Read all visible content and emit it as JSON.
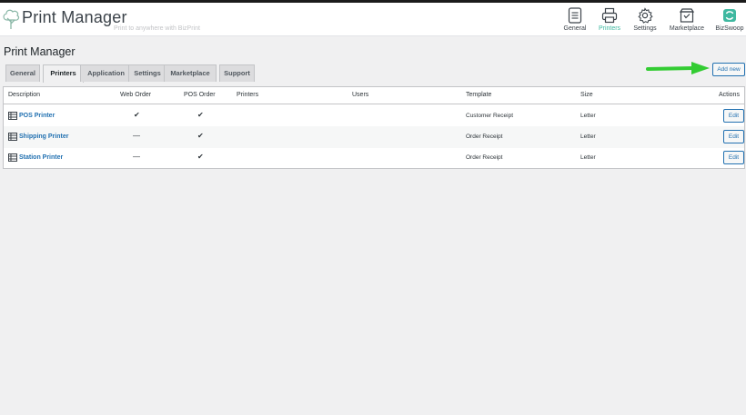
{
  "header": {
    "app_title": "Print Manager",
    "tagline": "Print to anywhere with BizPrint",
    "nav": [
      {
        "label": "General",
        "icon": "list-icon"
      },
      {
        "label": "Printers",
        "icon": "printer-icon"
      },
      {
        "label": "Settings",
        "icon": "gear-icon"
      },
      {
        "label": "Marketplace",
        "icon": "store-icon"
      },
      {
        "label": "BizSwoop",
        "icon": "bizswoop-icon"
      }
    ],
    "active_nav": "Printers",
    "accent_color": "#3fb8a0"
  },
  "page": {
    "title": "Print Manager",
    "tabs": [
      {
        "label": "General"
      },
      {
        "label": "Printers"
      },
      {
        "label": "Application"
      },
      {
        "label": "Settings"
      },
      {
        "label": "Marketplace"
      },
      {
        "label": "Support"
      }
    ],
    "active_tab": "Printers",
    "add_new_label": "Add new"
  },
  "table": {
    "columns": [
      "Description",
      "Web Order",
      "POS Order",
      "Printers",
      "Users",
      "Template",
      "Size",
      "Actions"
    ],
    "rows": [
      {
        "name": "POS Printer",
        "web_order": "✔",
        "pos_order": "✔",
        "printers": "",
        "users": "",
        "template": "Customer Receipt",
        "size": "Letter",
        "action": "Edit"
      },
      {
        "name": "Shipping Printer",
        "web_order": "—",
        "pos_order": "✔",
        "printers": "",
        "users": "",
        "template": "Order Receipt",
        "size": "Letter",
        "action": "Edit"
      },
      {
        "name": "Station Printer",
        "web_order": "—",
        "pos_order": "✔",
        "printers": "",
        "users": "",
        "template": "Order Receipt",
        "size": "Letter",
        "action": "Edit"
      }
    ]
  },
  "colors": {
    "link": "#2271b1",
    "arrow": "#33cc33"
  }
}
